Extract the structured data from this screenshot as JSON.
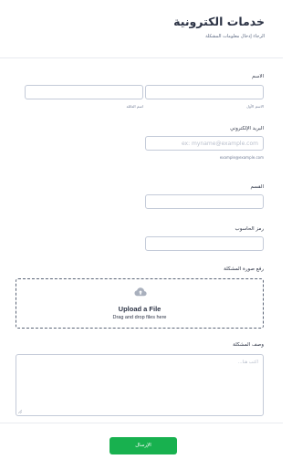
{
  "header": {
    "title": "خدمات الكترونية",
    "subtitle": "الرجاء إدخال معلومات المشكلة"
  },
  "name_field": {
    "label": "الاسم",
    "first_sublabel": "الاسم الأول",
    "last_sublabel": "اسم العائلة"
  },
  "email_field": {
    "label": "البريد الإلكتروني",
    "placeholder": "ex: myname@example.com",
    "sublabel": "example@example.com"
  },
  "department_field": {
    "label": "القسم"
  },
  "computer_code_field": {
    "label": "رمز الحاسوب"
  },
  "upload_field": {
    "label": "رفع صورة المشكلة",
    "title": "Upload a File",
    "subtitle": "Drag and drop files here",
    "icon": "cloud-upload-icon"
  },
  "description_field": {
    "label": "وصف المشكلة",
    "placeholder": "اكتب هنا..."
  },
  "submit": {
    "label": "الإرسال"
  },
  "colors": {
    "accent": "#18b14f",
    "border": "#c3cad8",
    "text": "#2c3345"
  }
}
